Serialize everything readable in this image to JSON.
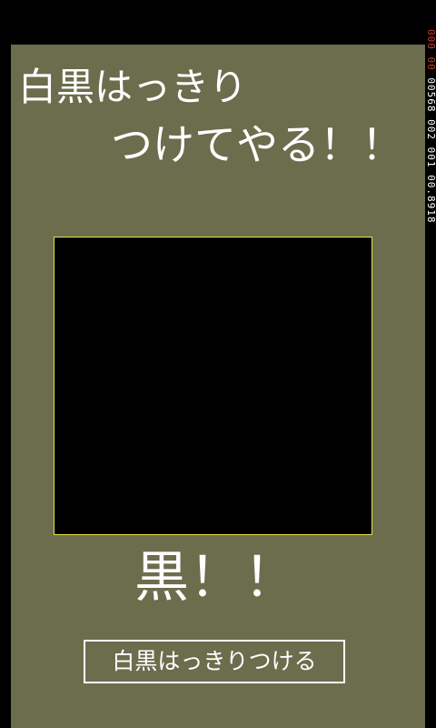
{
  "title": {
    "line1": "白黒はっきり",
    "line2": "つけてやる！！"
  },
  "result": {
    "text": "黒！！"
  },
  "button": {
    "label": "白黒はっきりつける"
  },
  "debug": {
    "red_part": "000 00",
    "white_part": "00568 002 001 00.8918"
  },
  "colors": {
    "panel": "#6b6d4d",
    "canvas": "#000000",
    "canvas_border": "#e2e24a",
    "text": "#ffffff",
    "debug_red": "#d23a2a"
  }
}
